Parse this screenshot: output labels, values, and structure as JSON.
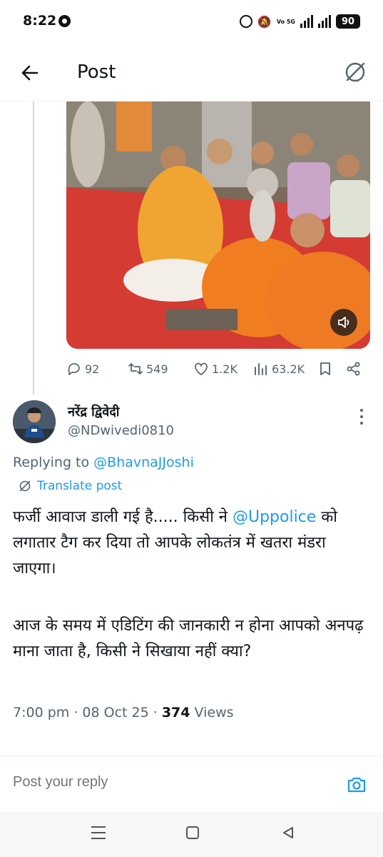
{
  "status_bar": {
    "time": "8:22",
    "network": "5G",
    "volte": "Vo 5G",
    "battery": "90"
  },
  "header": {
    "title": "Post",
    "back_icon": "arrow-left-icon",
    "grok_icon": "grok-icon"
  },
  "quoted_post": {
    "stats": {
      "replies": "92",
      "reposts": "549",
      "likes": "1.2K",
      "views": "63.2K"
    }
  },
  "reply_post": {
    "author_name": "नरेंद्र द्विवेदी",
    "author_handle": "@NDwivedi0810",
    "replying_prefix": "Replying to ",
    "replying_to": "@BhavnaJJoshi",
    "translate_label": "Translate post",
    "body_part1_before": "फर्जी आवाज डाली गई है..... किसी ने ",
    "body_mention": "@Uppolice",
    "body_part1_after": " को लगातार टैग कर दिया तो आपके लोकतंत्र में खतरा मंडरा जाएगा।",
    "body_part2": "आज के समय में एडिटिंग की जानकारी न होना आपको अनपढ़ माना जाता है, किसी ने सिखाया नहीं क्या?",
    "time": "7:00 pm",
    "date": "08 Oct 25",
    "views_count": "374",
    "views_label": " Views"
  },
  "composer": {
    "placeholder": "Post your reply"
  },
  "colors": {
    "accent": "#1d9bf0",
    "secondary_text": "#536471",
    "primary_text": "#0f1419"
  }
}
